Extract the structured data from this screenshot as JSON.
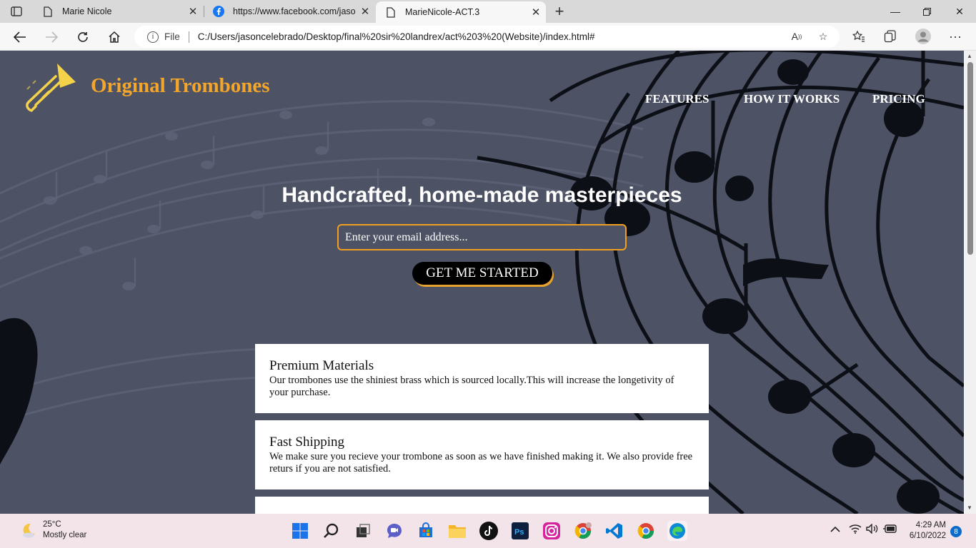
{
  "browser": {
    "tabs": [
      {
        "title": "Marie Nicole",
        "icon": "page-icon"
      },
      {
        "title": "https://www.facebook.com/jaso",
        "icon": "facebook-icon"
      },
      {
        "title": "MarieNicole-ACT.3",
        "icon": "page-icon",
        "active": true
      }
    ],
    "address": {
      "file_label": "File",
      "url": "C:/Users/jasoncelebrado/Desktop/final%20sir%20landrex/act%203%20(Website)/index.html#"
    }
  },
  "page": {
    "brand": "Original Trombones",
    "brand_color": "#f4a62a",
    "background_color": "#4d5264",
    "nav": {
      "features": "FEATURES",
      "how_it_works": "HOW IT WORKS",
      "pricing": "PRICING"
    },
    "hero": {
      "title": "Handcrafted, home-made masterpieces",
      "email_placeholder": "Enter your email address...",
      "cta": "GET ME STARTED"
    },
    "features": [
      {
        "title": "Premium Materials",
        "text": "Our trombones use the shiniest brass which is sourced locally.This will increase the longetivity of your purchase."
      },
      {
        "title": "Fast Shipping",
        "text": "We make sure you recieve your trombone as soon as we have finished making it. We also provide free returs if you are not satisfied."
      }
    ]
  },
  "taskbar": {
    "weather": {
      "temp": "25°C",
      "condition": "Mostly clear"
    },
    "clock": {
      "time": "4:29 AM",
      "date": "6/10/2022"
    },
    "notifications": "8"
  }
}
